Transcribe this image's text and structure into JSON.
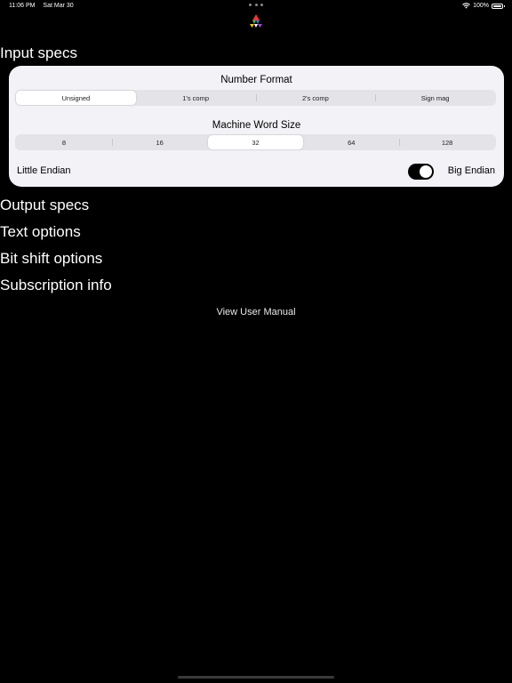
{
  "status_bar": {
    "time": "11:06 PM",
    "date": "Sat Mar 30",
    "battery": "100%"
  },
  "sections": {
    "input_specs": "Input specs",
    "output_specs": "Output specs",
    "text_options": "Text options",
    "bit_shift_options": "Bit shift options",
    "subscription_info": "Subscription info"
  },
  "input_card": {
    "number_format": {
      "title": "Number Format",
      "options": [
        "Unsigned",
        "1's comp",
        "2's comp",
        "Sign mag"
      ],
      "selected": "Unsigned"
    },
    "word_size": {
      "title": "Machine Word Size",
      "options": [
        "8",
        "16",
        "32",
        "64",
        "128"
      ],
      "selected": "32"
    },
    "endian": {
      "left_label": "Little Endian",
      "right_label": "Big Endian",
      "big_endian_on": true
    }
  },
  "manual_link": "View User Manual",
  "colors": {
    "background": "#000000",
    "card": "#f2f2f7",
    "segment_track": "#e3e3e8",
    "toggle_on": "#000000"
  }
}
